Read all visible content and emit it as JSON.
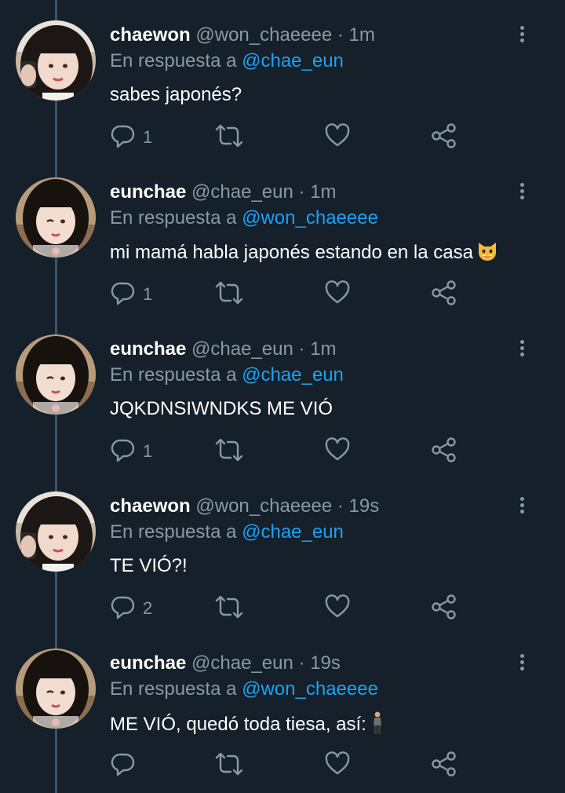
{
  "icons": {
    "reply": "reply-icon",
    "retweet": "retweet-icon",
    "like": "heart-icon",
    "share": "share-icon",
    "more": "more-vertical-icon"
  },
  "colors": {
    "background": "#15202b",
    "text": "#ffffff",
    "secondary": "#8899a6",
    "link": "#1da1f2",
    "thread_line": "#3d5466"
  },
  "reply_prefix": "En respuesta a",
  "tweets": [
    {
      "name": "chaewon",
      "handle": "@won_chaeeee",
      "dot": "·",
      "time": "1m",
      "reply_to": "@chae_eun",
      "text": "sabes japonés?",
      "reply_count": "1",
      "emoji": ""
    },
    {
      "name": "eunchae",
      "handle": "@chae_eun",
      "dot": "·",
      "time": "1m",
      "reply_to": "@won_chaeeee",
      "text": "mi mamá habla japonés estando en la casa",
      "reply_count": "1",
      "emoji": "grinning-cat-emoji"
    },
    {
      "name": "eunchae",
      "handle": "@chae_eun",
      "dot": "·",
      "time": "1m",
      "reply_to": "@chae_eun",
      "text": "JQKDNSIWNDKS ME VIÓ",
      "reply_count": "1",
      "emoji": ""
    },
    {
      "name": "chaewon",
      "handle": "@won_chaeeee",
      "dot": "·",
      "time": "19s",
      "reply_to": "@chae_eun",
      "text": "TE VIÓ?!",
      "reply_count": "2",
      "emoji": ""
    },
    {
      "name": "eunchae",
      "handle": "@chae_eun",
      "dot": "·",
      "time": "19s",
      "reply_to": "@won_chaeeee",
      "text": "ME VIÓ, quedó toda tiesa, así:",
      "reply_count": "",
      "emoji": "standing-man-emoji"
    }
  ]
}
